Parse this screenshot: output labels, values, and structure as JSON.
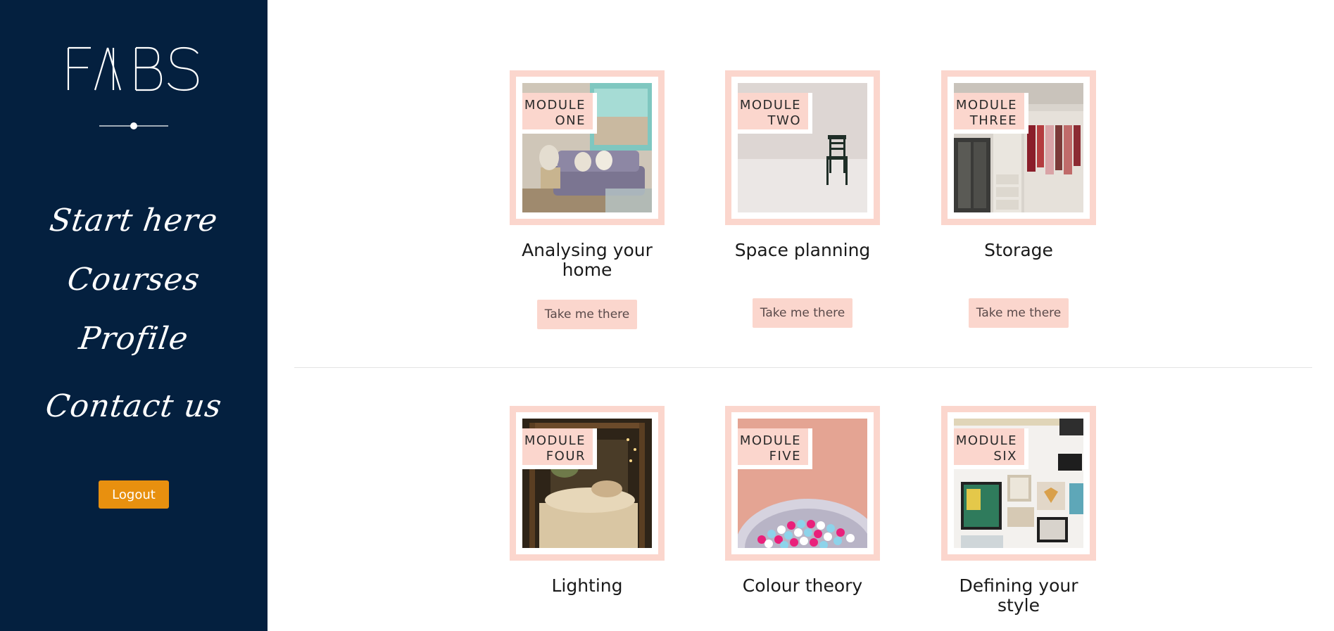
{
  "brand": {
    "logo_text": "FABS"
  },
  "sidebar": {
    "nav": [
      {
        "label": "Start here"
      },
      {
        "label": "Courses"
      },
      {
        "label": "Profile"
      },
      {
        "label": "Contact us"
      }
    ],
    "logout_label": "Logout"
  },
  "modules": [
    {
      "tag_line1": "MODULE",
      "tag_line2": "ONE",
      "title": "Analysing your home",
      "button": "Take me there",
      "image": "living-room-sofa-image"
    },
    {
      "tag_line1": "MODULE",
      "tag_line2": "TWO",
      "title": "Space planning",
      "button": "Take me there",
      "image": "empty-room-chair-image"
    },
    {
      "tag_line1": "MODULE",
      "tag_line2": "THREE",
      "title": "Storage",
      "button": "Take me there",
      "image": "wardrobe-closet-image"
    },
    {
      "tag_line1": "MODULE",
      "tag_line2": "FOUR",
      "title": "Lighting",
      "image": "bedroom-lights-image"
    },
    {
      "tag_line1": "MODULE",
      "tag_line2": "FIVE",
      "title": "Colour theory",
      "image": "bowl-of-candies-image"
    },
    {
      "tag_line1": "MODULE",
      "tag_line2": "SIX",
      "title": "Defining your style",
      "image": "gallery-wall-frames-image"
    }
  ],
  "colors": {
    "sidebar_bg": "#04203f",
    "accent_pink": "#fbd6cd",
    "logout_orange": "#e8900f"
  }
}
